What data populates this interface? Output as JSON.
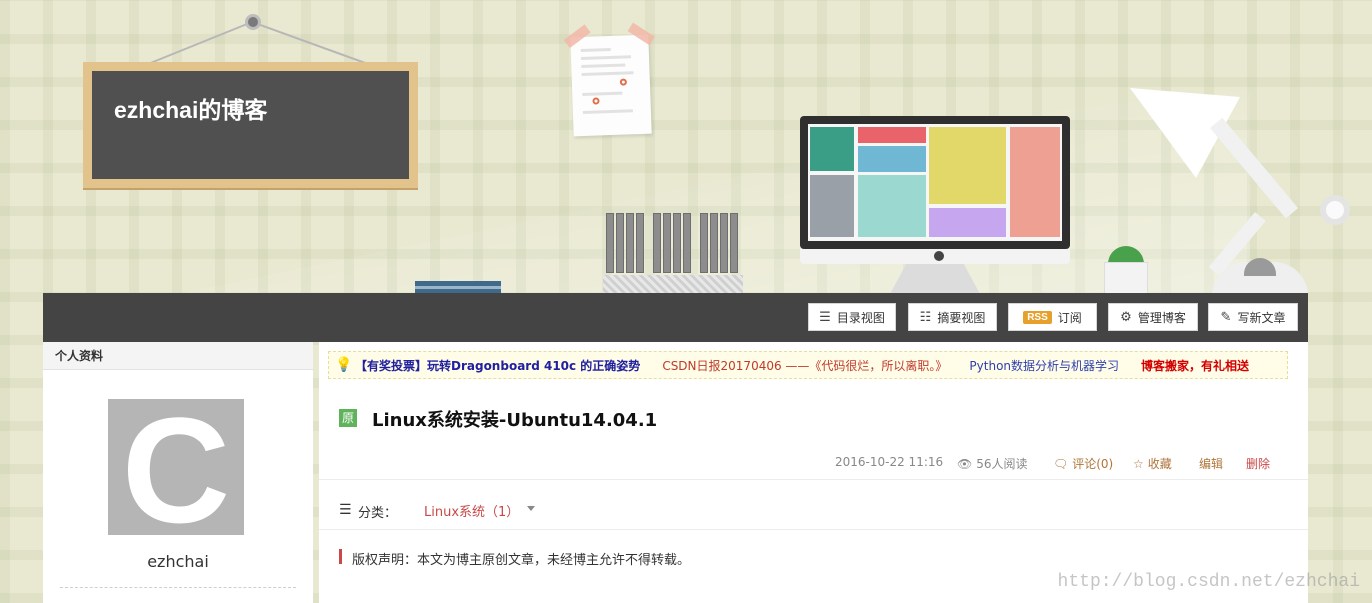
{
  "blog": {
    "title": "ezhchai的博客"
  },
  "toolbar": {
    "directory_view": "目录视图",
    "summary_view": "摘要视图",
    "rss_badge": "RSS",
    "subscribe": "订阅",
    "manage_blog": "管理博客",
    "write_article": "写新文章"
  },
  "sidebar": {
    "section_title": "个人资料",
    "avatar_letter": "C",
    "username": "ezhchai"
  },
  "notice": {
    "items": [
      "【有奖投票】玩转Dragonboard 410c 的正确姿势",
      "CSDN日报20170406 ——《代码很烂，所以离职。》",
      "Python数据分析与机器学习",
      "博客搬家，有礼相送"
    ]
  },
  "article": {
    "badge": "原",
    "title": "Linux系统安装-Ubuntu14.04.1",
    "date": "2016-10-22 11:16",
    "reads": "56人阅读",
    "comments": "评论(0)",
    "favorite": "收藏",
    "edit": "编辑",
    "delete": "删除",
    "category_label": "分类：",
    "category_value": "Linux系统（1）",
    "copyright": "版权声明：本文为博主原创文章，未经博主允许不得转载。"
  },
  "watermark": "http://blog.csdn.net/ezhchai",
  "colors": {
    "toolbar_bg": "#444444",
    "accent_red": "#c94848",
    "rss": "#e8a02c",
    "original_badge": "#5fb35a"
  }
}
